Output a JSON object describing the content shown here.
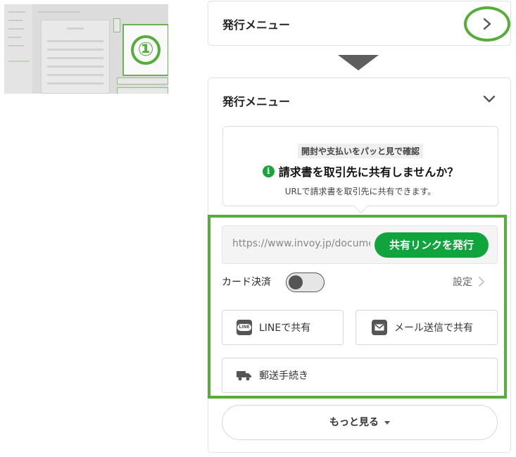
{
  "thumbnail": {
    "step_badge": "①"
  },
  "collapsed_card": {
    "title": "発行メニュー"
  },
  "expanded_card": {
    "title": "発行メニュー",
    "info": {
      "pill": "開封や支払いをパッと見で確認",
      "headline": "請求書を取引先に共有しませんか？",
      "sub": "URLで請求書を取引先に共有できます。"
    },
    "share_link": {
      "url": "https://www.invoy.jp/documents",
      "button": "共有リンクを発行"
    },
    "card_payment": {
      "label": "カード決済",
      "settings": "設定"
    },
    "buttons": {
      "line": "LINEで共有",
      "line_icon_text": "LINE",
      "mail": "メール送信で共有",
      "post": "郵送手続き"
    },
    "more": "もっと見る"
  },
  "colors": {
    "highlight": "#57ad3a",
    "primary_button": "#10a53c",
    "info_icon": "#1aa53a"
  }
}
